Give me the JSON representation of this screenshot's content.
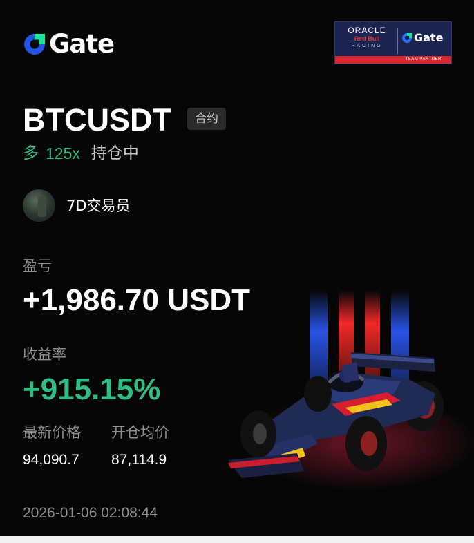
{
  "brand": {
    "logo_text": "Gate"
  },
  "sponsor": {
    "oracle": "ORACLE",
    "redbull": "Red Bull",
    "racing": "RACING",
    "gate": "Gate",
    "footer": "TEAM PARTNER"
  },
  "position": {
    "symbol": "BTCUSDT",
    "contract_tag": "合约",
    "side": "多",
    "leverage": "125x",
    "status": "持仓中"
  },
  "trader": {
    "name": "7D交易员"
  },
  "pnl": {
    "label": "盈亏",
    "value": "+1,986.70 USDT"
  },
  "roi": {
    "label": "收益率",
    "value": "+915.15%"
  },
  "prices": {
    "latest_label": "最新价格",
    "latest_value": "94,090.7",
    "entry_label": "开仓均价",
    "entry_value": "87,114.9"
  },
  "timestamp": "2026-01-06 02:08:44",
  "colors": {
    "accent_green": "#2fbd85",
    "brand_blue": "#2354e6",
    "brand_green": "#17e59a",
    "background": "#060606",
    "muted_text": "#8f8f8f"
  },
  "icons": {
    "logo": "gate-logo-icon",
    "car": "f1-car-illustration"
  }
}
